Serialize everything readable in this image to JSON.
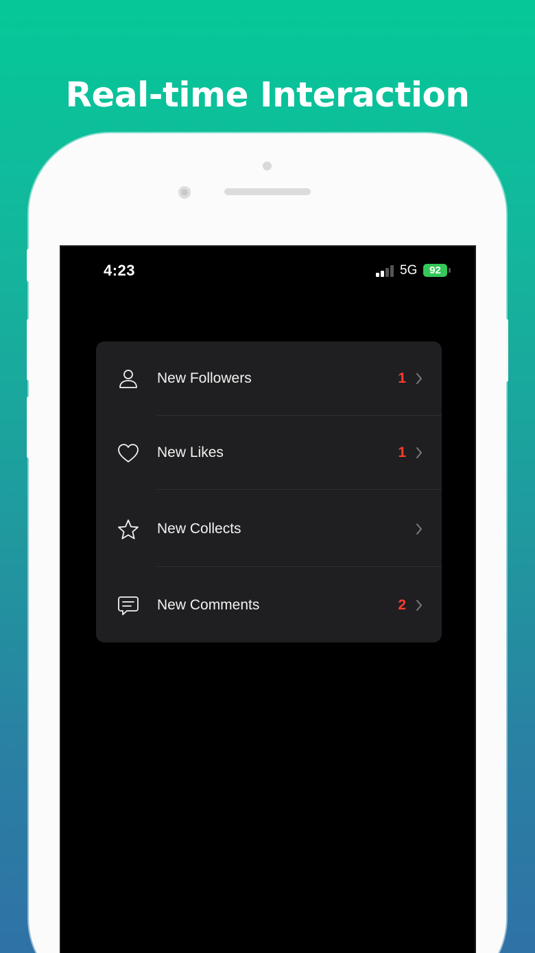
{
  "headline": "Real-time Interaction",
  "status_bar": {
    "time": "4:23",
    "network": "5G",
    "battery": "92"
  },
  "colors": {
    "badge": "#ff3b30",
    "battery": "#34c759",
    "card": "#1f1f21"
  },
  "notifications": [
    {
      "label": "New Followers",
      "count": "1",
      "icon": "person-icon"
    },
    {
      "label": "New Likes",
      "count": "1",
      "icon": "heart-icon"
    },
    {
      "label": "New Collects",
      "count": "",
      "icon": "star-icon"
    },
    {
      "label": "New Comments",
      "count": "2",
      "icon": "comment-icon"
    }
  ]
}
